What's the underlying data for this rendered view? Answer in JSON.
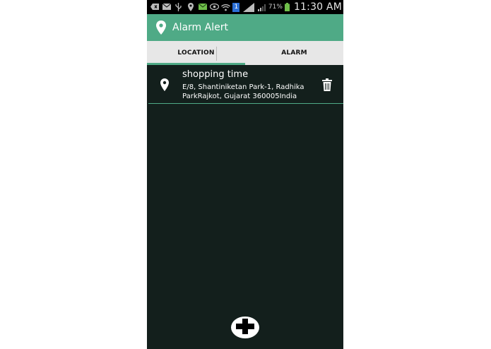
{
  "status_bar": {
    "battery_percent": "71%",
    "time": "11:30 AM",
    "sim_badge": "1"
  },
  "app_bar": {
    "title": "Alarm Alert",
    "icon": "location-pin-icon",
    "color": "#4faa86"
  },
  "tabs": [
    {
      "label": "LOCATION",
      "selected": true
    },
    {
      "label": "ALARM",
      "selected": false
    }
  ],
  "locations": [
    {
      "title": "shopping time",
      "address": "E/8, Shantiniketan Park-1, Radhika ParkRajkot, Gujarat 360005India"
    }
  ],
  "fab": {
    "icon": "plus-icon"
  }
}
